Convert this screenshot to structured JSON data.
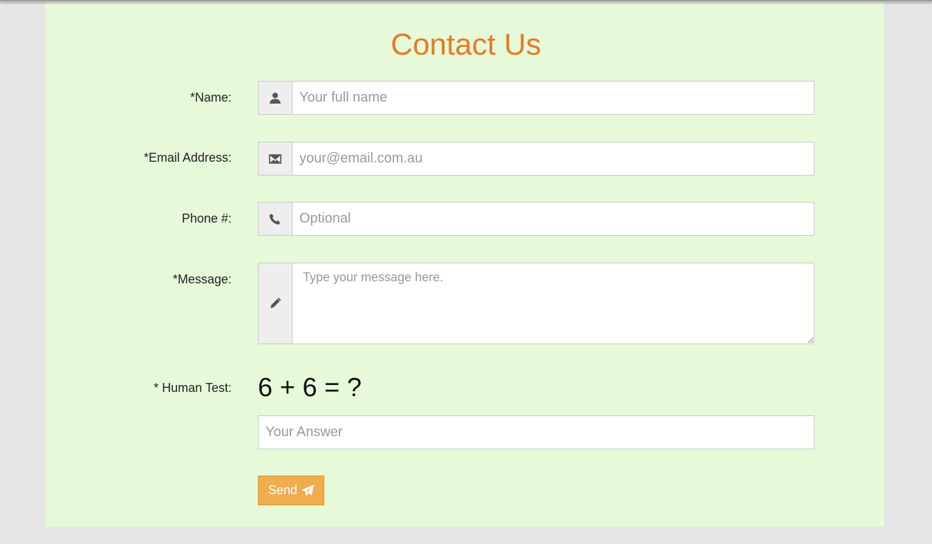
{
  "page": {
    "title": "Contact Us",
    "title_color": "#e57b24",
    "panel_color": "#e6f9d9"
  },
  "form": {
    "name": {
      "label": "*Name:",
      "placeholder": "Your full name",
      "icon": "user-icon"
    },
    "email": {
      "label": "*Email Address:",
      "placeholder": "your@email.com.au",
      "icon": "envelope-icon"
    },
    "phone": {
      "label": "Phone #:",
      "placeholder": "Optional",
      "icon": "phone-icon"
    },
    "message": {
      "label": "*Message:",
      "placeholder": "Type your message here.",
      "icon": "pencil-icon"
    },
    "human_test": {
      "label": "* Human Test:",
      "question": "6 + 6 = ?",
      "placeholder": "Your Answer"
    },
    "send": {
      "label": "Send",
      "icon": "paper-plane-icon",
      "color": "#f0ad4e"
    }
  }
}
